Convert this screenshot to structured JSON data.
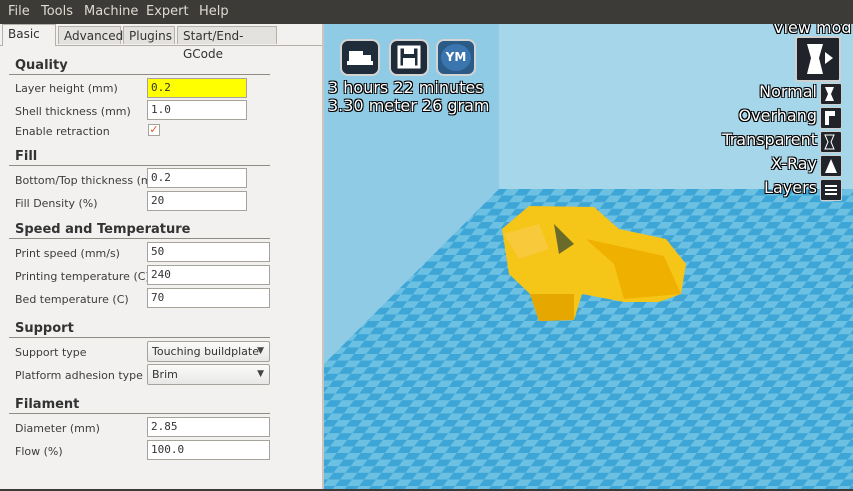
{
  "menu": {
    "items": [
      "File",
      "Tools",
      "Machine",
      "Expert",
      "Help"
    ]
  },
  "tabs": [
    "Basic",
    "Advanced",
    "Plugins",
    "Start/End-GCode"
  ],
  "quality": {
    "title": "Quality",
    "layer_height_label": "Layer height (mm)",
    "layer_height": "0.2",
    "shell_thickness_label": "Shell thickness (mm)",
    "shell_thickness": "1.0",
    "retraction_label": "Enable retraction"
  },
  "fill": {
    "title": "Fill",
    "bottom_top_label": "Bottom/Top thickness (mm)",
    "bottom_top": "0.2",
    "density_label": "Fill Density (%)",
    "density": "20"
  },
  "speed": {
    "title": "Speed and Temperature",
    "print_speed_label": "Print speed (mm/s)",
    "print_speed": "50",
    "print_temp_label": "Printing temperature (C)",
    "print_temp": "240",
    "bed_temp_label": "Bed temperature (C)",
    "bed_temp": "70"
  },
  "support": {
    "title": "Support",
    "type_label": "Support type",
    "type": "Touching buildplate",
    "adhesion_label": "Platform adhesion type",
    "adhesion": "Brim"
  },
  "filament": {
    "title": "Filament",
    "diameter_label": "Diameter (mm)",
    "diameter": "2.85",
    "flow_label": "Flow (%)",
    "flow": "100.0"
  },
  "viewport": {
    "ym_label": "YM",
    "time": "3 hours 22 minutes",
    "material": "3.30 meter 26 gram",
    "view_mode_label": "View mod",
    "modes": [
      "Normal",
      "Overhang",
      "Transparent",
      "X-Ray",
      "Layers"
    ]
  },
  "icons": [
    "load-model-icon",
    "save-toolpath-icon",
    "youmagine-icon",
    "view-mode-icon",
    "normal-view-icon",
    "overhang-view-icon",
    "transparent-view-icon",
    "xray-view-icon",
    "layers-view-icon",
    "checkbox-checked-icon",
    "dropdown-arrow-icon"
  ],
  "colors": {
    "model": "#f5b800",
    "platform": "#5fb3d8",
    "menubar": "#3c3b37",
    "highlight": "#ffff00"
  }
}
